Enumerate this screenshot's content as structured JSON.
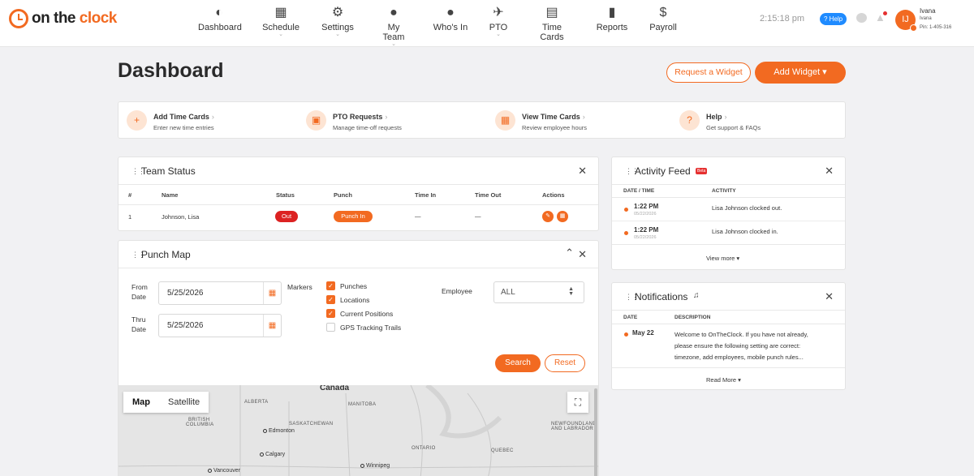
{
  "brand": {
    "name_part1": "on the",
    "name_part2": "clock"
  },
  "nav": [
    {
      "label": "Dashboard",
      "icon": "gauge-icon",
      "glyph": "◐"
    },
    {
      "label": "Schedule",
      "icon": "calendar-clock-icon",
      "glyph": "▦"
    },
    {
      "label": "Settings",
      "icon": "gears-icon",
      "glyph": "⚙"
    },
    {
      "label": "My Team",
      "icon": "team-icon",
      "glyph": "●"
    },
    {
      "label": "Who's In",
      "icon": "person-clock-icon",
      "glyph": "●"
    },
    {
      "label": "PTO",
      "icon": "plane-icon",
      "glyph": "✈"
    },
    {
      "label": "Time Cards",
      "icon": "timecard-icon",
      "glyph": "▤"
    },
    {
      "label": "Reports",
      "icon": "bar-chart-icon",
      "glyph": "▮"
    },
    {
      "label": "Payroll",
      "icon": "dollar-icon",
      "glyph": "$"
    }
  ],
  "header": {
    "time": "2:15:18 pm",
    "help_label": "? Help",
    "user_initial": "IJ",
    "user_name": "Ivana",
    "user_sub": "Ivana",
    "user_pin": "Pin: 1-405-316"
  },
  "page": {
    "title": "Dashboard",
    "request_widget": "Request a Widget",
    "add_widget": "Add Widget ▾"
  },
  "quick_links": [
    {
      "title": "Add Time Cards",
      "sub": "Enter new time entries",
      "icon": "plus-circle-icon",
      "glyph": "+"
    },
    {
      "title": "PTO Requests",
      "sub": "Manage time-off requests",
      "icon": "clipboard-icon",
      "glyph": "▣"
    },
    {
      "title": "View Time Cards",
      "sub": "Review employee hours",
      "icon": "calendar-icon",
      "glyph": "▦"
    },
    {
      "title": "Help",
      "sub": "Get support & FAQs",
      "icon": "question-icon",
      "glyph": "?"
    }
  ],
  "team_status": {
    "title": "Team Status",
    "columns": [
      "#",
      "Name",
      "Status",
      "Punch",
      "Time In",
      "Time Out",
      "Actions"
    ],
    "rows": [
      {
        "num": "1",
        "name": "Johnson, Lisa",
        "status": "Out",
        "punch": "Punch In",
        "time_in": "—",
        "time_out": "—"
      }
    ]
  },
  "punch_map": {
    "title": "Punch Map",
    "from_label1": "From",
    "from_label2": "Date",
    "from_value": "5/25/2026",
    "thru_label1": "Thru",
    "thru_label2": "Date",
    "thru_value": "5/25/2026",
    "markers_label": "Markers",
    "markers": [
      {
        "label": "Punches",
        "checked": true
      },
      {
        "label": "Locations",
        "checked": true
      },
      {
        "label": "Current Positions",
        "checked": true
      },
      {
        "label": "GPS Tracking Trails",
        "checked": false
      }
    ],
    "employee_label": "Employee",
    "employee_value": "ALL",
    "search_label": "Search",
    "reset_label": "Reset",
    "map_tab": "Map",
    "satellite_tab": "Satellite",
    "map_labels": {
      "canada": "Canada",
      "alberta": "ALBERTA",
      "manitoba": "MANITOBA",
      "bc1": "BRITISH",
      "bc2": "COLUMBIA",
      "sask": "SASKATCHEWAN",
      "edmonton": "Edmonton",
      "calgary": "Calgary",
      "vancouver": "Vancouver",
      "winnipeg": "Winnipeg",
      "ontario": "ONTARIO",
      "quebec": "QUEBEC",
      "nl1": "NEWFOUNDLAND",
      "nl2": "AND LABRADOR"
    }
  },
  "activity_feed": {
    "title": "Activity Feed",
    "badge": "Beta",
    "col_date": "DATE / TIME",
    "col_activity": "ACTIVITY",
    "items": [
      {
        "time": "1:22 PM",
        "date": "05/22/2026",
        "activity": "Lisa Johnson clocked out."
      },
      {
        "time": "1:22 PM",
        "date": "05/22/2026",
        "activity": "Lisa Johnson clocked in."
      }
    ],
    "view_more": "View more  ▾"
  },
  "notifications": {
    "title": "Notifications",
    "col_date": "DATE",
    "col_desc": "DESCRIPTION",
    "items": [
      {
        "date": "May 22",
        "line1": "Welcome to OnTheClock. If you have not already,",
        "line2": "please ensure the following setting are correct:",
        "line3": "timezone, add employees, mobile punch rules..."
      }
    ],
    "read_more": "Read More  ▾"
  },
  "colors": {
    "accent": "#f26a21",
    "danger": "#dc2222",
    "help_blue": "#1f8bff"
  }
}
